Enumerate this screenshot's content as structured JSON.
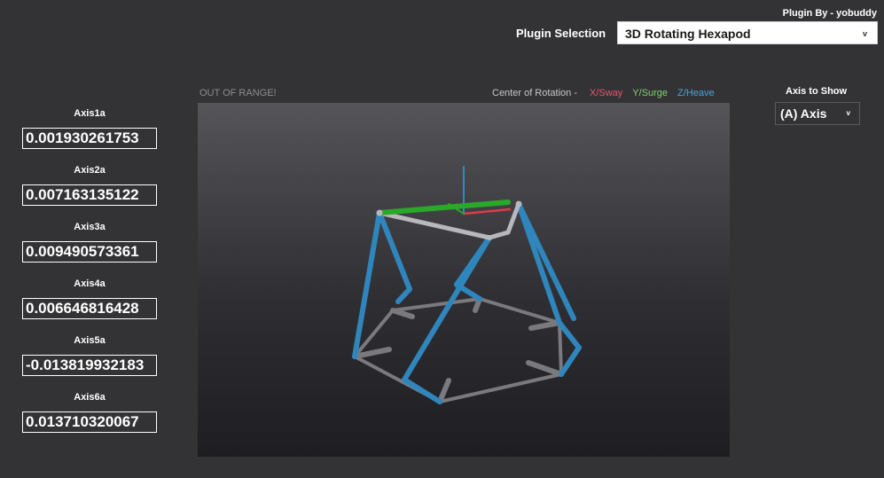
{
  "header": {
    "plugin_by": "Plugin By - yobuddy",
    "plugin_selection_label": "Plugin Selection",
    "plugin_selected": "3D Rotating Hexapod",
    "chevron": "v"
  },
  "axis_panel": {
    "label": "Axis to Show",
    "selected": "(A) Axis",
    "chevron": "v"
  },
  "axes": [
    {
      "name": "Axis1a",
      "value": "0.001930261753"
    },
    {
      "name": "Axis2a",
      "value": "0.007163135122"
    },
    {
      "name": "Axis3a",
      "value": "0.009490573361"
    },
    {
      "name": "Axis4a",
      "value": "0.006646816428"
    },
    {
      "name": "Axis5a",
      "value": "-0.013819932183"
    },
    {
      "name": "Axis6a",
      "value": "0.013710320067"
    }
  ],
  "viewport": {
    "status": "OUT OF RANGE!",
    "legend_label": "Center of Rotation  -",
    "legend_x": "X/Sway",
    "legend_y": "Y/Surge",
    "legend_z": "Z/Heave",
    "colors": {
      "x": "#e03a48",
      "y": "#2aa82a",
      "z": "#2e8ac6",
      "actuator": "#2f86bd",
      "frame": "#7a7a7e",
      "platform": "#b8b8bc"
    }
  }
}
